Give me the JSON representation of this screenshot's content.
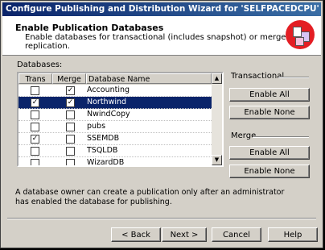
{
  "window": {
    "title": "Configure Publishing and Distribution Wizard for 'SELFPACEDCPU'"
  },
  "header": {
    "title": "Enable Publication Databases",
    "description": "Enable databases for transactional (includes snapshot) or merge replication.",
    "icon": "wizard-documents-icon"
  },
  "databases": {
    "label": "Databases:",
    "columns": [
      "Trans",
      "Merge",
      "Database Name"
    ],
    "rows": [
      {
        "trans": false,
        "merge": true,
        "name": "Accounting",
        "selected": false
      },
      {
        "trans": true,
        "merge": true,
        "name": "Northwind",
        "selected": true
      },
      {
        "trans": false,
        "merge": false,
        "name": "NwindCopy",
        "selected": false
      },
      {
        "trans": false,
        "merge": false,
        "name": "pubs",
        "selected": false
      },
      {
        "trans": true,
        "merge": false,
        "name": "SSEMDB",
        "selected": false
      },
      {
        "trans": false,
        "merge": false,
        "name": "TSQLDB",
        "selected": false
      },
      {
        "trans": false,
        "merge": false,
        "name": "WizardDB",
        "selected": false
      }
    ]
  },
  "transactional": {
    "label": "Transactional",
    "enable_all": "Enable All",
    "enable_none": "Enable None"
  },
  "merge": {
    "label": "Merge",
    "enable_all": "Enable All",
    "enable_none": "Enable None"
  },
  "note": "A database owner can create a publication only after an administrator has enabled the database for publishing.",
  "footer": {
    "back": "< Back",
    "next": "Next >",
    "cancel": "Cancel",
    "help": "Help"
  }
}
